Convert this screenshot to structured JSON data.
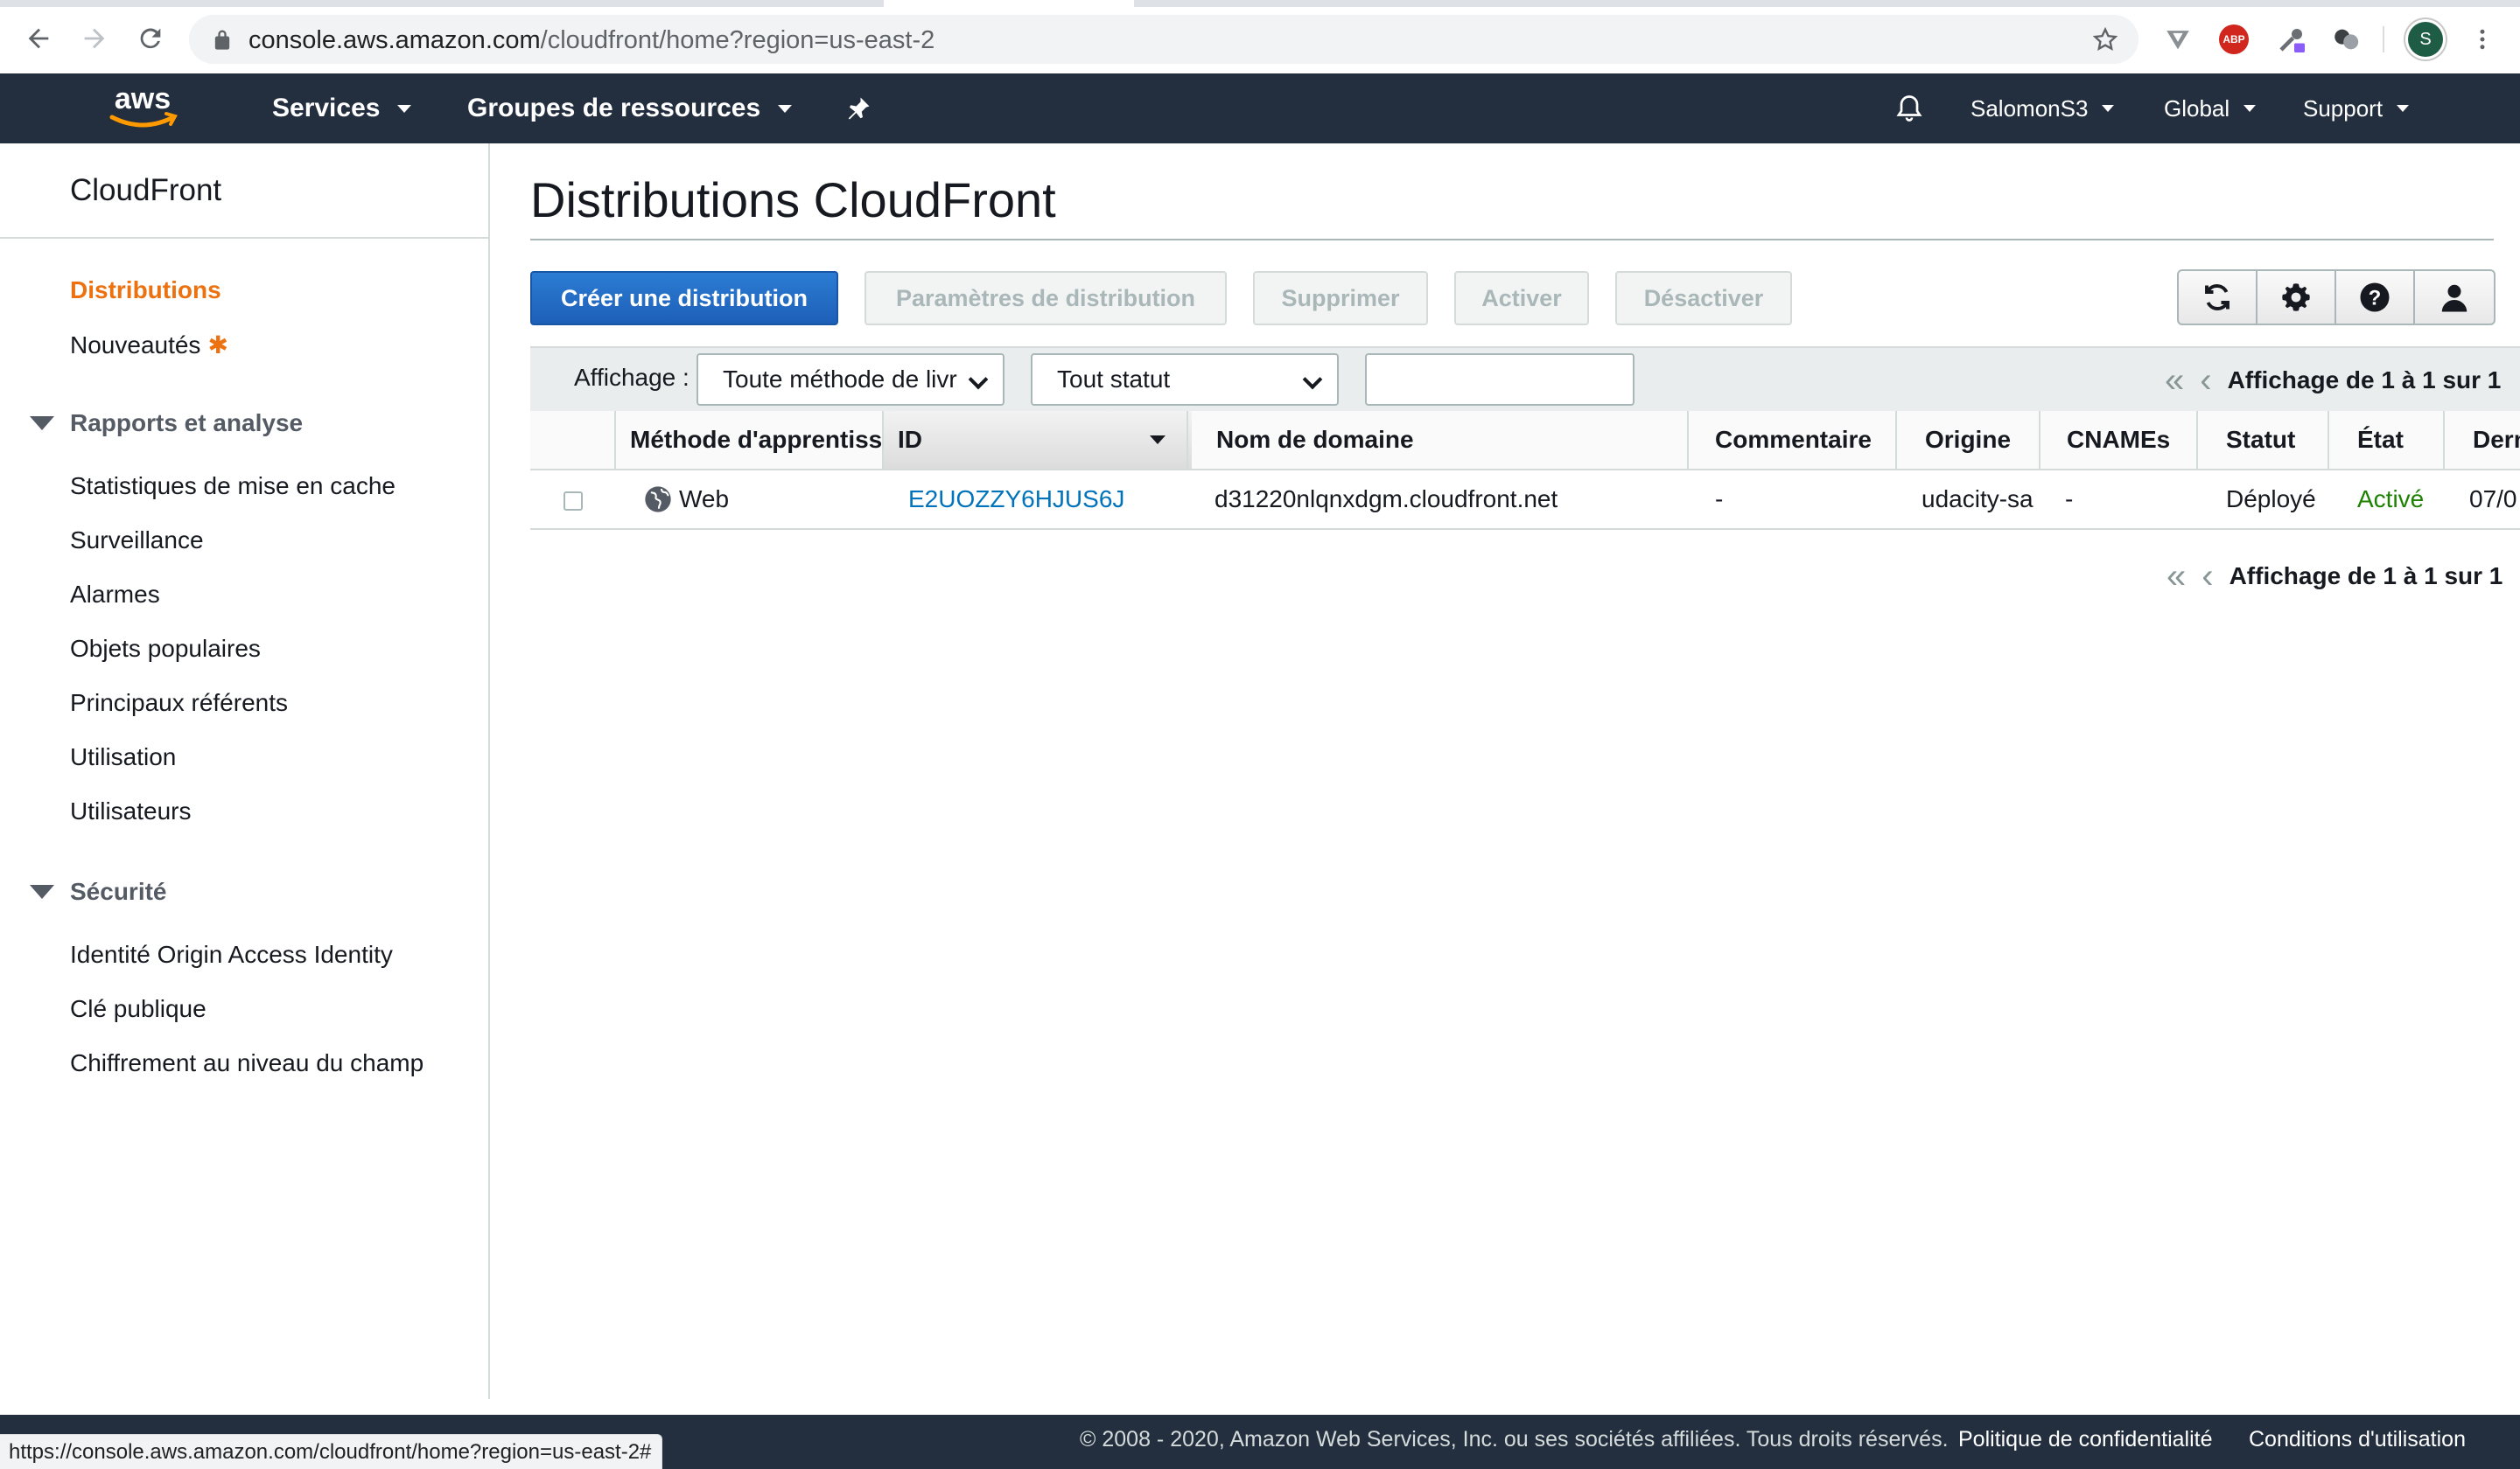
{
  "browser": {
    "url_host": "console.aws.amazon.com",
    "url_path": "/cloudfront/home?region=us-east-2",
    "profile_initial": "S",
    "adblock_label": "ABP",
    "status_url": "https://console.aws.amazon.com/cloudfront/home?region=us-east-2#"
  },
  "aws_nav": {
    "services": "Services",
    "resource_groups": "Groupes de ressources",
    "user": "SalomonS3",
    "region": "Global",
    "support": "Support"
  },
  "sidebar": {
    "title": "CloudFront",
    "distributions": "Distributions",
    "whats_new": "Nouveautés",
    "whats_new_badge": "✱",
    "section_reports": "Rapports et analyse",
    "reports": [
      "Statistiques de mise en cache",
      "Surveillance",
      "Alarmes",
      "Objets populaires",
      "Principaux référents",
      "Utilisation",
      "Utilisateurs"
    ],
    "section_security": "Sécurité",
    "security": [
      "Identité Origin Access Identity",
      "Clé publique",
      "Chiffrement au niveau du champ"
    ]
  },
  "main": {
    "title": "Distributions CloudFront",
    "buttons": {
      "create": "Créer une distribution",
      "settings": "Paramètres de distribution",
      "delete": "Supprimer",
      "enable": "Activer",
      "disable": "Désactiver"
    },
    "filter": {
      "label": "Affichage :",
      "delivery_method": "Toute méthode de livr",
      "status": "Tout statut",
      "search_value": ""
    },
    "pager_text": "Affichage de 1 à 1 sur 1",
    "columns": {
      "delivery": "Méthode d'apprentissage",
      "id": "ID",
      "domain": "Nom de domaine",
      "comment": "Commentaire",
      "origin": "Origine",
      "cnames": "CNAMEs",
      "status": "Statut",
      "state": "État",
      "last": "Dernière modification"
    },
    "rows": [
      {
        "delivery": "Web",
        "id": "E2UOZZY6HJUS6J",
        "domain": "d31220nlqnxdgm.cloudfront.net",
        "comment": "-",
        "origin": "udacity-sa",
        "cnames": "-",
        "status": "Déployé",
        "state": "Activé",
        "last": "07/0"
      }
    ]
  },
  "footer": {
    "copyright": "© 2008 - 2020, Amazon Web Services, Inc. ou ses sociétés affiliées. Tous droits réservés.",
    "privacy": "Politique de confidentialité",
    "terms": "Conditions d'utilisation"
  },
  "colors": {
    "aws_nav": "#232f3e",
    "active_link": "#ec7211",
    "primary_button": "#1e5fb8",
    "link": "#0073bb",
    "enabled_green": "#1d8102"
  }
}
